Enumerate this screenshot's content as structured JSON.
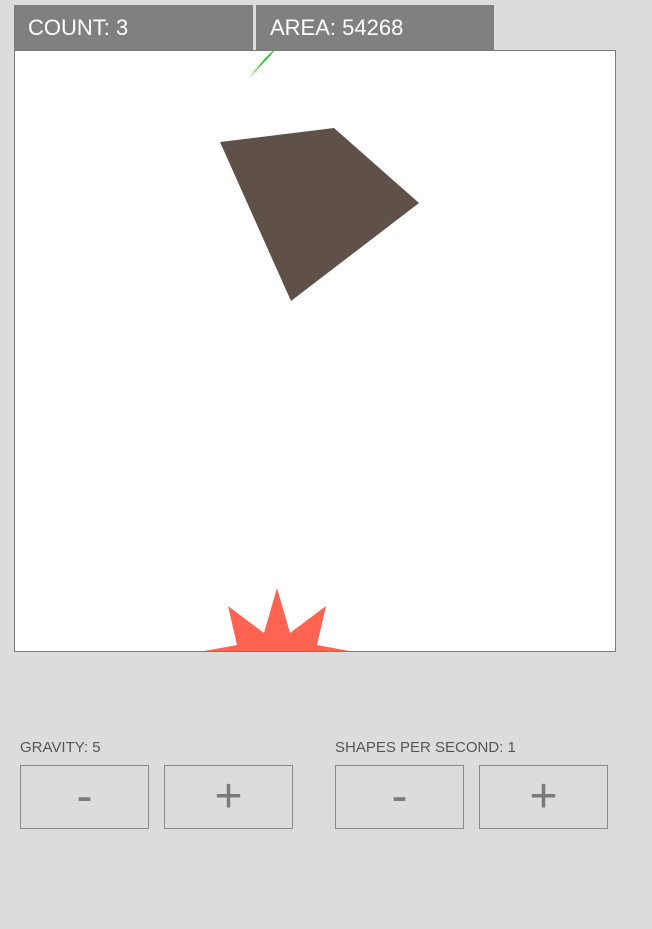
{
  "stats": {
    "count_text": "COUNT: 3",
    "area_text": "AREA: 54268"
  },
  "shapes": [
    {
      "kind": "quad",
      "color": "#5f504a"
    },
    {
      "kind": "star",
      "color": "#ff6352"
    },
    {
      "kind": "triangle",
      "color": "#3ec43e"
    }
  ],
  "controls": {
    "gravity_label": "GRAVITY: 5",
    "gravity_minus": "-",
    "gravity_plus": "+",
    "sps_label": "SHAPES PER SECOND: 1",
    "sps_minus": "-",
    "sps_plus": "+"
  }
}
